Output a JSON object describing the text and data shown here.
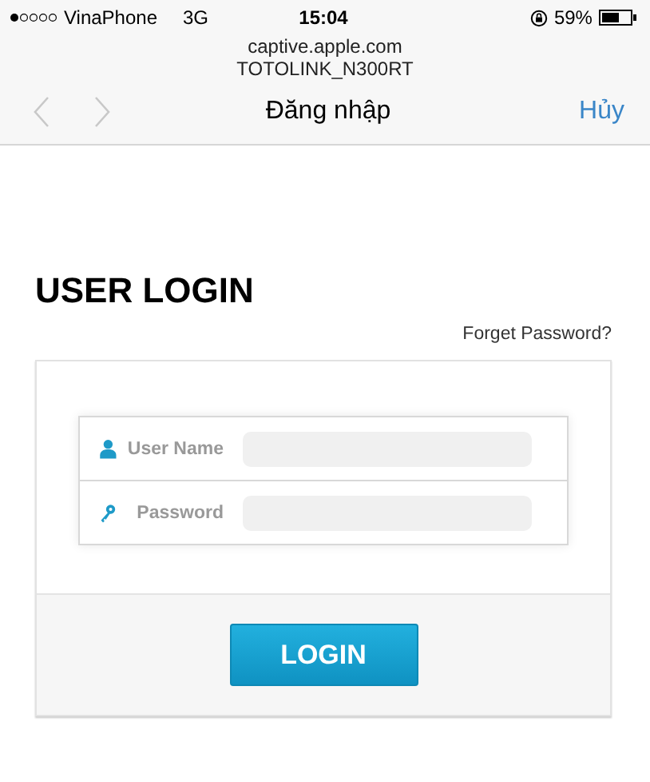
{
  "status_bar": {
    "carrier": "VinaPhone",
    "network": "3G",
    "time": "15:04",
    "battery": "59%"
  },
  "browser": {
    "domain": "captive.apple.com",
    "network_name": "TOTOLINK_N300RT",
    "title": "Đăng nhập",
    "cancel": "Hủy",
    "back_disabled": true,
    "forward_disabled": true
  },
  "page": {
    "heading": "USER LOGIN",
    "forgot_link": "Forget Password?",
    "fields": [
      {
        "kind": "user",
        "label": "User Name"
      },
      {
        "kind": "key",
        "label": "Password"
      }
    ],
    "login_button": "LOGIN"
  }
}
